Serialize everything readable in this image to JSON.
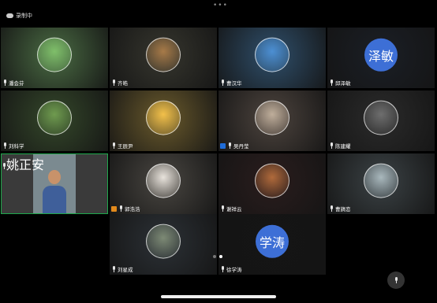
{
  "status": {
    "recording_label": "录制中"
  },
  "participants": [
    {
      "name": "潘会芬",
      "avatar": "owl-avatar",
      "bg": "#4a6b43",
      "ring": "#7fbf6a"
    },
    {
      "name": "齐皓",
      "avatar": "sunset-avatar",
      "bg": "#36362e",
      "ring": "#a77a48"
    },
    {
      "name": "曹汉华",
      "avatar": "signpost-avatar",
      "bg": "#2f4f6b",
      "ring": "#4c8fd3"
    },
    {
      "name": "邱泽敏",
      "avatar": "泽敏",
      "bg": "#1b1f26",
      "text_avatar": true
    },
    {
      "name": "刘科学",
      "avatar": "landscape-avatar",
      "bg": "#34472a",
      "ring": "#6f9b4f"
    },
    {
      "name": "王辰尹",
      "avatar": "bear-avatar",
      "bg": "#6a5a2c",
      "ring": "#f2c04a"
    },
    {
      "name": "吴丹莹",
      "avatar": "hands-avatar",
      "bg": "#4d443e",
      "ring": "#bfae9b",
      "host": true
    },
    {
      "name": "陈建耀",
      "avatar": "rock-avatar",
      "bg": "#2b2b2b",
      "ring": "#6e6e6e"
    },
    {
      "name": "姚正安",
      "video": true
    },
    {
      "name": "郭浩浩",
      "avatar": "cartoon-avatar",
      "bg": "#494641",
      "ring": "#e8e3dc",
      "host_orange": true
    },
    {
      "name": "谢祥云",
      "avatar": "nebula-avatar",
      "bg": "#2a1d1d",
      "ring": "#b06a3b"
    },
    {
      "name": "曹旖恋",
      "avatar": "photo-avatar",
      "bg": "#3b4245",
      "ring": "#a9b8bd"
    },
    {
      "name": "刘星成",
      "avatar": "mountain-avatar",
      "bg": "#2c3136",
      "ring": "#7d8a75"
    },
    {
      "name": "徐学涛",
      "avatar": "学涛",
      "bg": "#151515",
      "text_avatar": true
    }
  ],
  "pager": {
    "pages": 2,
    "current": 2
  }
}
